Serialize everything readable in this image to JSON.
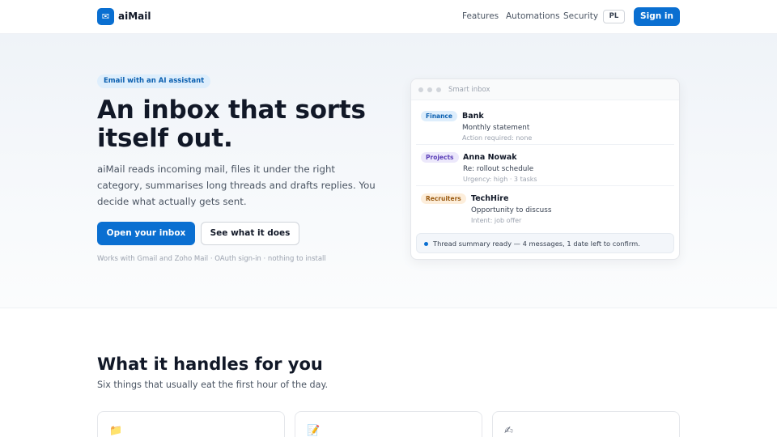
{
  "header": {
    "logo_icon": "✉",
    "brand": "aiMail",
    "nav": [
      "Features",
      "Automations",
      "Security"
    ],
    "lang": "PL",
    "signin": "Sign in"
  },
  "hero": {
    "badge": "Email with an AI assistant",
    "title": "An inbox that sorts itself out.",
    "subtitle": "aiMail reads incoming mail, files it under the right category, summarises long threads and drafts replies. You decide what actually gets sent.",
    "primary_cta": "Open your inbox",
    "secondary_cta": "See what it does",
    "note": "Works with Gmail and Zoho Mail · OAuth sign-in · nothing to install"
  },
  "inbox": {
    "title": "Smart inbox",
    "messages": [
      {
        "tag": "Finance",
        "tag_bg": "#deeefc",
        "tag_color": "#0a5fb0",
        "from": "Bank",
        "subject": "Monthly statement",
        "meta": "Action required: none"
      },
      {
        "tag": "Projects",
        "tag_bg": "#ece8fb",
        "tag_color": "#5b3fb8",
        "from": "Anna Nowak",
        "subject": "Re: rollout schedule",
        "meta": "Urgency: high · 3 tasks"
      },
      {
        "tag": "Recruiters",
        "tag_bg": "#fdeedb",
        "tag_color": "#9a5a10",
        "from": "TechHire",
        "subject": "Opportunity to discuss",
        "meta": "Intent: job offer"
      }
    ],
    "summary": "Thread summary ready — 4 messages, 1 date left to confirm."
  },
  "features": {
    "title": "What it handles for you",
    "subtitle": "Six things that usually eat the first hour of the day.",
    "cards": [
      {
        "icon": "📁",
        "icon_name": "folder-icon"
      },
      {
        "icon": "📝",
        "icon_name": "memo-icon"
      },
      {
        "icon": "✍",
        "icon_name": "writing-hand-icon"
      }
    ]
  },
  "colors": {
    "accent": "#0a6fd1",
    "text": "#111827",
    "muted": "#4b5563"
  }
}
